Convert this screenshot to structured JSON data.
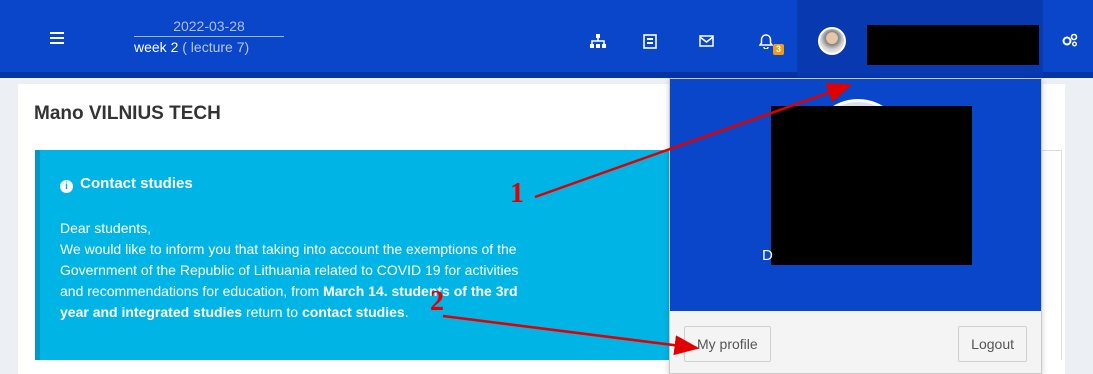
{
  "header": {
    "date": "2022-03-28",
    "week": "week 2",
    "lecture": "( lecture 7)",
    "notification_count": "3"
  },
  "main": {
    "title": "Mano VILNIUS TECH",
    "callout": {
      "title": "Contact studies",
      "greeting": "Dear students,",
      "line1": "We would like to inform you that taking into account the exemptions of the",
      "line2": "Government of the Republic of Lithuania related to COVID 19 for activities",
      "line3_plain": "and recommendations for education, from ",
      "line3_bold": "March 14. students of the 3rd",
      "line4_bold": "year and integrated studies",
      "line4_plain": " return to ",
      "line4_bold2": "contact studies",
      "line4_end": "."
    }
  },
  "dropdown": {
    "name_fragment": "D",
    "profile_label": "My profile",
    "logout_label": "Logout"
  },
  "annotations": {
    "label1": "1",
    "label2": "2",
    "color": "#e00000"
  },
  "icons": [
    "menu-icon",
    "sitemap-icon",
    "book-icon",
    "mail-icon",
    "bell-icon",
    "avatar",
    "gears-icon",
    "info-icon"
  ]
}
